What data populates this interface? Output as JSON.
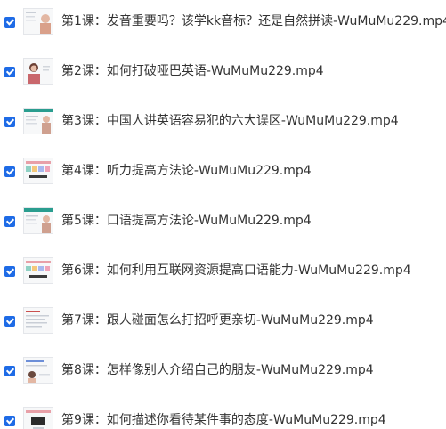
{
  "files": [
    {
      "name": "第1课：发音重要吗？该学kk音标？还是自然拼读-WuMuMu229.mp4",
      "checked": true,
      "thumb_icon": "video-thumbnail-icon",
      "thumb_style": "person-right"
    },
    {
      "name": "第2课：如何打破哑巴英语-WuMuMu229.mp4",
      "checked": true,
      "thumb_icon": "video-thumbnail-icon",
      "thumb_style": "person-left"
    },
    {
      "name": "第3课：中国人讲英语容易犯的六大误区-WuMuMu229.mp4",
      "checked": true,
      "thumb_icon": "video-thumbnail-icon",
      "thumb_style": "slide-person"
    },
    {
      "name": "第4课：听力提高方法论-WuMuMu229.mp4",
      "checked": true,
      "thumb_icon": "video-thumbnail-icon",
      "thumb_style": "slide-bars"
    },
    {
      "name": "第5课：口语提高方法论-WuMuMu229.mp4",
      "checked": true,
      "thumb_icon": "video-thumbnail-icon",
      "thumb_style": "slide-person"
    },
    {
      "name": "第6课：如何利用互联网资源提高口语能力-WuMuMu229.mp4",
      "checked": true,
      "thumb_icon": "video-thumbnail-icon",
      "thumb_style": "slide-bars"
    },
    {
      "name": "第7课：跟人碰面怎么打招呼更亲切-WuMuMu229.mp4",
      "checked": true,
      "thumb_icon": "video-thumbnail-icon",
      "thumb_style": "slide-text"
    },
    {
      "name": "第8课：怎样像别人介绍自己的朋友-WuMuMu229.mp4",
      "checked": true,
      "thumb_icon": "video-thumbnail-icon",
      "thumb_style": "slide-person-low"
    },
    {
      "name": "第9课：如何描述你看待某件事的态度-WuMuMu229.mp4",
      "checked": true,
      "thumb_icon": "video-thumbnail-icon",
      "thumb_style": "slide-dark"
    }
  ],
  "colors": {
    "checkbox": "#1e6be6",
    "text": "#333333"
  }
}
